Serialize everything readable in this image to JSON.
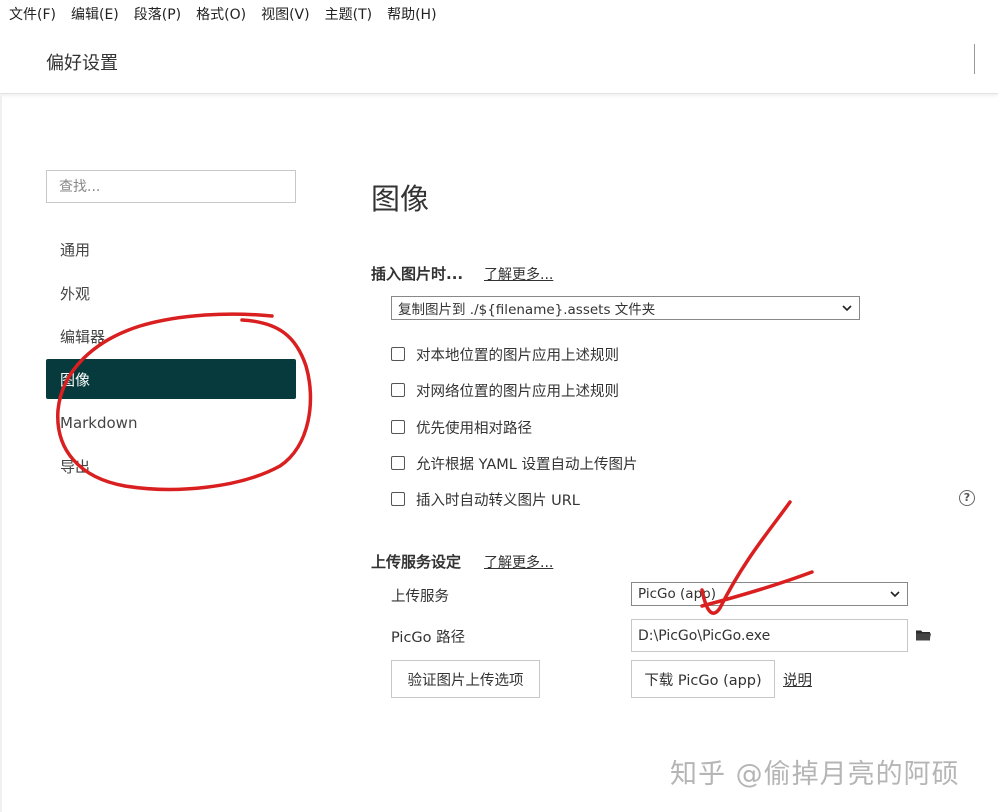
{
  "menubar": [
    "文件(F)",
    "编辑(E)",
    "段落(P)",
    "格式(O)",
    "视图(V)",
    "主题(T)",
    "帮助(H)"
  ],
  "window": {
    "title": "偏好设置"
  },
  "sidebar": {
    "search_placeholder": "查找...",
    "items": [
      {
        "label": "通用",
        "active": false
      },
      {
        "label": "外观",
        "active": false
      },
      {
        "label": "编辑器",
        "active": false
      },
      {
        "label": "图像",
        "active": true
      },
      {
        "label": "Markdown",
        "active": false
      },
      {
        "label": "导出",
        "active": false
      }
    ]
  },
  "main": {
    "heading": "图像",
    "insert": {
      "label": "插入图片时...",
      "learn_more": "了解更多...",
      "selected": "复制图片到 ./${filename}.assets 文件夹",
      "options": [
        {
          "label": "对本地位置的图片应用上述规则",
          "checked": false
        },
        {
          "label": "对网络位置的图片应用上述规则",
          "checked": false
        },
        {
          "label": "优先使用相对路径",
          "checked": false
        },
        {
          "label": "允许根据 YAML 设置自动上传图片",
          "checked": false
        },
        {
          "label": "插入时自动转义图片 URL",
          "checked": false
        }
      ],
      "help_icon": "?"
    },
    "upload": {
      "label": "上传服务设定",
      "learn_more": "了解更多...",
      "service_label": "上传服务",
      "service_value": "PicGo (app)",
      "path_label": "PicGo 路径",
      "path_value": "D:\\PicGo\\PicGo.exe",
      "verify_button": "验证图片上传选项",
      "download_button": "下载 PicGo (app)",
      "doc_link": "说明"
    }
  },
  "watermark": "知乎 @偷掉月亮的阿硕",
  "colors": {
    "active_bg": "#063a3c",
    "annotation": "#d91f1f"
  }
}
